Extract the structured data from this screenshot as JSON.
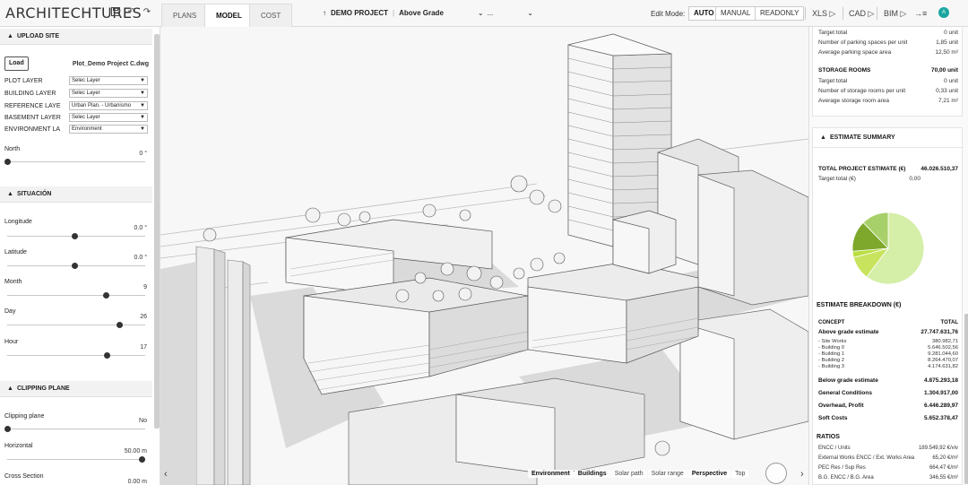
{
  "app": {
    "logo": "ARCHITECHTURES"
  },
  "toolbar": {
    "save_icon": "save-icon",
    "undo_icon": "undo-icon",
    "redo_icon": "redo-icon"
  },
  "view_tabs": [
    {
      "label": "PLANS",
      "active": false
    },
    {
      "label": "MODEL",
      "active": true
    },
    {
      "label": "COST",
      "active": false
    }
  ],
  "project": {
    "name": "DEMO PROJECT",
    "grade": "Above Grade",
    "more": "..."
  },
  "edit_mode": {
    "label": "Edit Mode:",
    "options": [
      "AUTO",
      "MANUAL",
      "READONLY"
    ],
    "selected": "AUTO"
  },
  "exports": [
    {
      "label": "XLS ▷"
    },
    {
      "label": "CAD ▷"
    },
    {
      "label": "BIM ▷"
    }
  ],
  "user": {
    "initial": "A"
  },
  "upload_site": {
    "title": "UPLOAD SITE",
    "load_button": "Load",
    "file_name": "Plot_Demo Project C.dwg",
    "layers": [
      {
        "label": "PLOT LAYER",
        "value": "Selec Layer"
      },
      {
        "label": "BUILDING LAYER",
        "value": "Selec Layer"
      },
      {
        "label": "REFERENCE LAYE",
        "value": "Urban Plan. - Urbanismo"
      },
      {
        "label": "BASEMENT LAYER",
        "value": "Selec Layer"
      },
      {
        "label": "ENVIRONMENT LA",
        "value": "Environment"
      }
    ],
    "north": {
      "label": "North",
      "value": "0 °",
      "fraction": 0.0
    }
  },
  "situacion": {
    "title": "SITUACIÓN",
    "sliders": [
      {
        "label": "Longitude",
        "value": "0.0 °",
        "fraction": 0.5
      },
      {
        "label": "Latitude",
        "value": "0.0 °",
        "fraction": 0.5
      },
      {
        "label": "Month",
        "value": "9",
        "fraction": 0.73
      },
      {
        "label": "Day",
        "value": "26",
        "fraction": 0.83
      },
      {
        "label": "Hour",
        "value": "17",
        "fraction": 0.74
      }
    ]
  },
  "clipping_plane": {
    "title": "CLIPPING PLANE",
    "sliders": [
      {
        "label": "Clipping plane",
        "value": "No",
        "fraction": 0.0
      },
      {
        "label": "Horizontal",
        "value": "50.00 m",
        "fraction": 1.0
      },
      {
        "label": "Cross Section",
        "value": "0.00 m",
        "fraction": 0.0
      }
    ]
  },
  "parking": {
    "rows": [
      {
        "label": "Target total",
        "value": "0 unit"
      },
      {
        "label": "Number of parking spaces per unit",
        "value": "1,85 unit"
      },
      {
        "label": "Average parking space area",
        "value": "12,50 m²"
      }
    ]
  },
  "storage": {
    "title": "STORAGE ROOMS",
    "total": "70,00 unit",
    "rows": [
      {
        "label": "Target total",
        "value": "0 unit"
      },
      {
        "label": "Number of storage rooms per unit",
        "value": "0,33 unit"
      },
      {
        "label": "Average storage room area",
        "value": "7,21 m²"
      }
    ]
  },
  "estimate_summary": {
    "title": "ESTIMATE SUMMARY",
    "total_label": "TOTAL PROJECT ESTIMATE (€)",
    "total_value": "46.026.510,37",
    "target_label": "Target total (€)",
    "target_value": "0,00"
  },
  "chart_data": {
    "type": "pie",
    "values": [
      27747631.76,
      4875293.18,
      1304917.0,
      6446289.97,
      5652378.47
    ],
    "colors": [
      "#d5eea8",
      "#c8e45e",
      "#b8de40",
      "#7ea82b",
      "#a8d06a"
    ]
  },
  "estimate_breakdown": {
    "title": "ESTIMATE BREAKDOWN (€)",
    "col_concept": "CONCEPT",
    "col_total": "TOTAL",
    "rows": [
      {
        "label": "Above grade estimate",
        "value": "27.747.631,76",
        "bold": true
      },
      {
        "label": "- Site Works",
        "value": "380.982,71",
        "bold": false
      },
      {
        "label": "- Building 0",
        "value": "5.646.502,56",
        "bold": false
      },
      {
        "label": "- Building 1",
        "value": "9.281.044,60",
        "bold": false
      },
      {
        "label": "- Building 2",
        "value": "8.264.470,07",
        "bold": false
      },
      {
        "label": "- Building 3",
        "value": "4.174.631,82",
        "bold": false
      },
      {
        "label": "Below grade estimate",
        "value": "4.875.293,18",
        "bold": true
      },
      {
        "label": "General Conditions",
        "value": "1.304.917,00",
        "bold": true
      },
      {
        "label": "Overhead, Profit",
        "value": "6.446.289,97",
        "bold": true
      },
      {
        "label": "Soft Costs",
        "value": "5.652.378,47",
        "bold": true
      }
    ]
  },
  "ratios": {
    "title": "RATIOS",
    "rows": [
      {
        "label": "ENCC / Units",
        "value": "189.549,92 €/viv"
      },
      {
        "label": "External Works ENCC / Ext. Works Area",
        "value": "65,20 €/m²"
      },
      {
        "label": "PEC Res / Sup Res",
        "value": "664,47 €/m²"
      },
      {
        "label": "B.G. ENCC / B.G. Area",
        "value": "346,55 €/m²"
      }
    ]
  },
  "viewport_toolbar": {
    "buttons": [
      {
        "label": "Environment",
        "active": true
      },
      {
        "label": "Buildings",
        "active": true
      },
      {
        "label": "Solar path",
        "active": false
      },
      {
        "label": "Solar range",
        "active": false
      },
      {
        "label": "Perspective",
        "active": true
      },
      {
        "label": "Top",
        "active": false
      }
    ]
  }
}
